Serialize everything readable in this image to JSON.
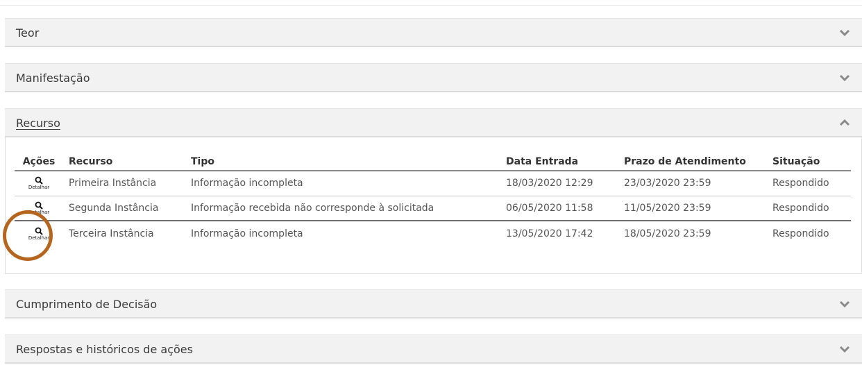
{
  "panels": {
    "teor": {
      "title": "Teor"
    },
    "manifestacao": {
      "title": "Manifestação"
    },
    "recurso": {
      "title": "Recurso"
    },
    "cumprimento": {
      "title": "Cumprimento de Decisão"
    },
    "respostas": {
      "title": "Respostas e históricos de ações"
    }
  },
  "recurso_table": {
    "headers": {
      "acoes": "Ações",
      "recurso": "Recurso",
      "tipo": "Tipo",
      "data_entrada": "Data Entrada",
      "prazo": "Prazo de Atendimento",
      "situacao": "Situação"
    },
    "action_label": "Detalhar",
    "rows": [
      {
        "recurso": "Primeira Instância",
        "tipo": "Informação incompleta",
        "data_entrada": "18/03/2020 12:29",
        "prazo": "23/03/2020 23:59",
        "situacao": "Respondido"
      },
      {
        "recurso": "Segunda Instância",
        "tipo": "Informação recebida não corresponde à solicitada",
        "data_entrada": "06/05/2020 11:58",
        "prazo": "11/05/2020 23:59",
        "situacao": "Respondido"
      },
      {
        "recurso": "Terceira Instância",
        "tipo": "Informação incompleta",
        "data_entrada": "13/05/2020 17:42",
        "prazo": "18/05/2020 23:59",
        "situacao": "Respondido"
      }
    ]
  },
  "icons": {
    "collapsed": "chevron-down-icon",
    "expanded": "chevron-up-icon",
    "detail": "magnifier-icon"
  },
  "colors": {
    "highlight_circle": "#b5651d",
    "panel_header_bg": "#f2f2f2"
  }
}
